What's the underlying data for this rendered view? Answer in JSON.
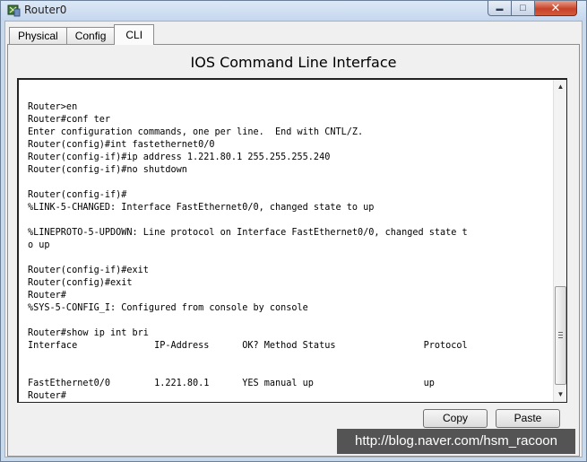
{
  "window": {
    "title": "Router0",
    "controls": {
      "minimize": "▬",
      "maximize": "□",
      "close": "✕"
    }
  },
  "tabs": [
    {
      "label": "Physical",
      "active": false
    },
    {
      "label": "Config",
      "active": false
    },
    {
      "label": "CLI",
      "active": true
    }
  ],
  "panel": {
    "title": "IOS Command Line Interface"
  },
  "terminal": {
    "lines": [
      "Router>en",
      "Router#conf ter",
      "Enter configuration commands, one per line.  End with CNTL/Z.",
      "Router(config)#int fastethernet0/0",
      "Router(config-if)#ip address 1.221.80.1 255.255.255.240",
      "Router(config-if)#no shutdown",
      "",
      "Router(config-if)#",
      "%LINK-5-CHANGED: Interface FastEthernet0/0, changed state to up",
      "",
      "%LINEPROTO-5-UPDOWN: Line protocol on Interface FastEthernet0/0, changed state t",
      "o up",
      "",
      "Router(config-if)#exit",
      "Router(config)#exit",
      "Router#",
      "%SYS-5-CONFIG_I: Configured from console by console",
      "",
      "Router#show ip int bri",
      "Interface              IP-Address      OK? Method Status                Protocol",
      "",
      "",
      "FastEthernet0/0        1.221.80.1      YES manual up                    up",
      "Router#"
    ]
  },
  "buttons": {
    "copy": "Copy",
    "paste": "Paste"
  },
  "watermark": "http://blog.naver.com/hsm_racoon"
}
